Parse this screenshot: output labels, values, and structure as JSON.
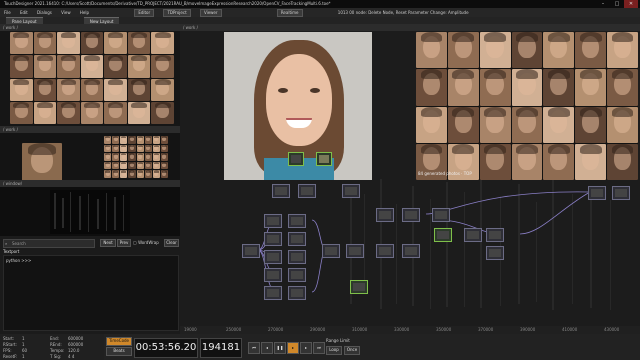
{
  "titlebar": {
    "title": "TouchDesigner 2021.16410: C:/Users/Scott/Documents/Derivative/TD_PROJECT/2021RAU_B/moveImageExpressionResearch2020/OpenCV_FaceTrackingMulti.6.toe*",
    "minimize": "–",
    "maximize": "□",
    "close": "✕"
  },
  "menubar": {
    "items": [
      "File",
      "Edit",
      "Dialogs",
      "View",
      "Help"
    ],
    "buttons": [
      "Editor",
      "TDProject",
      "Viewer",
      "Realtime"
    ],
    "pane_layout": "Pane Layout",
    "new_layout": "New Layout",
    "status_right": "1013 00 node: Delete Node, Reset Parameter Change: Amplitude"
  },
  "left_panes": {
    "top_path": "/ work /",
    "mid_path": "/ work /",
    "bottom_path": "/ window/"
  },
  "node_network": {
    "path": "/ work /",
    "overlay_text": "84 generated photos · TOP",
    "ruler_ticks": [
      "19000",
      "250000",
      "270000",
      "290000",
      "310000",
      "330000",
      "350000",
      "370000",
      "390000",
      "410000",
      "430000"
    ]
  },
  "textport": {
    "title": "Textport",
    "search_placeholder": "Search",
    "next": "Next",
    "prev": "Prev",
    "wordwrap": "WordWrap",
    "clear": "Clear",
    "prompt": "python >>>"
  },
  "stats": {
    "start_label": "Start:",
    "start_val": "1",
    "end_label": "End:",
    "end_val": "600000",
    "rstart_label": "RStart:",
    "rstart_val": "1",
    "rend_label": "REnd:",
    "rend_val": "600000",
    "fps_label": "FPS:",
    "fps_val": "60",
    "tempo_label": "Tempo:",
    "tempo_val": "120.0",
    "resetf_label": "ResetF:",
    "resetf_val": "1",
    "tsig_label": "T Sig:",
    "tsig_val": "4 4"
  },
  "timeline": {
    "time_code_label": "TimeCode",
    "beats_label": "Beats",
    "timecode": "00:53:56.20",
    "frame": "194181",
    "range_limit": "Range Limit",
    "loop": "Loop",
    "once": "Once"
  },
  "colors": {
    "accent_orange": "#d0882a",
    "node_border": "#6b6b85",
    "wire": "#8a7fc7"
  }
}
